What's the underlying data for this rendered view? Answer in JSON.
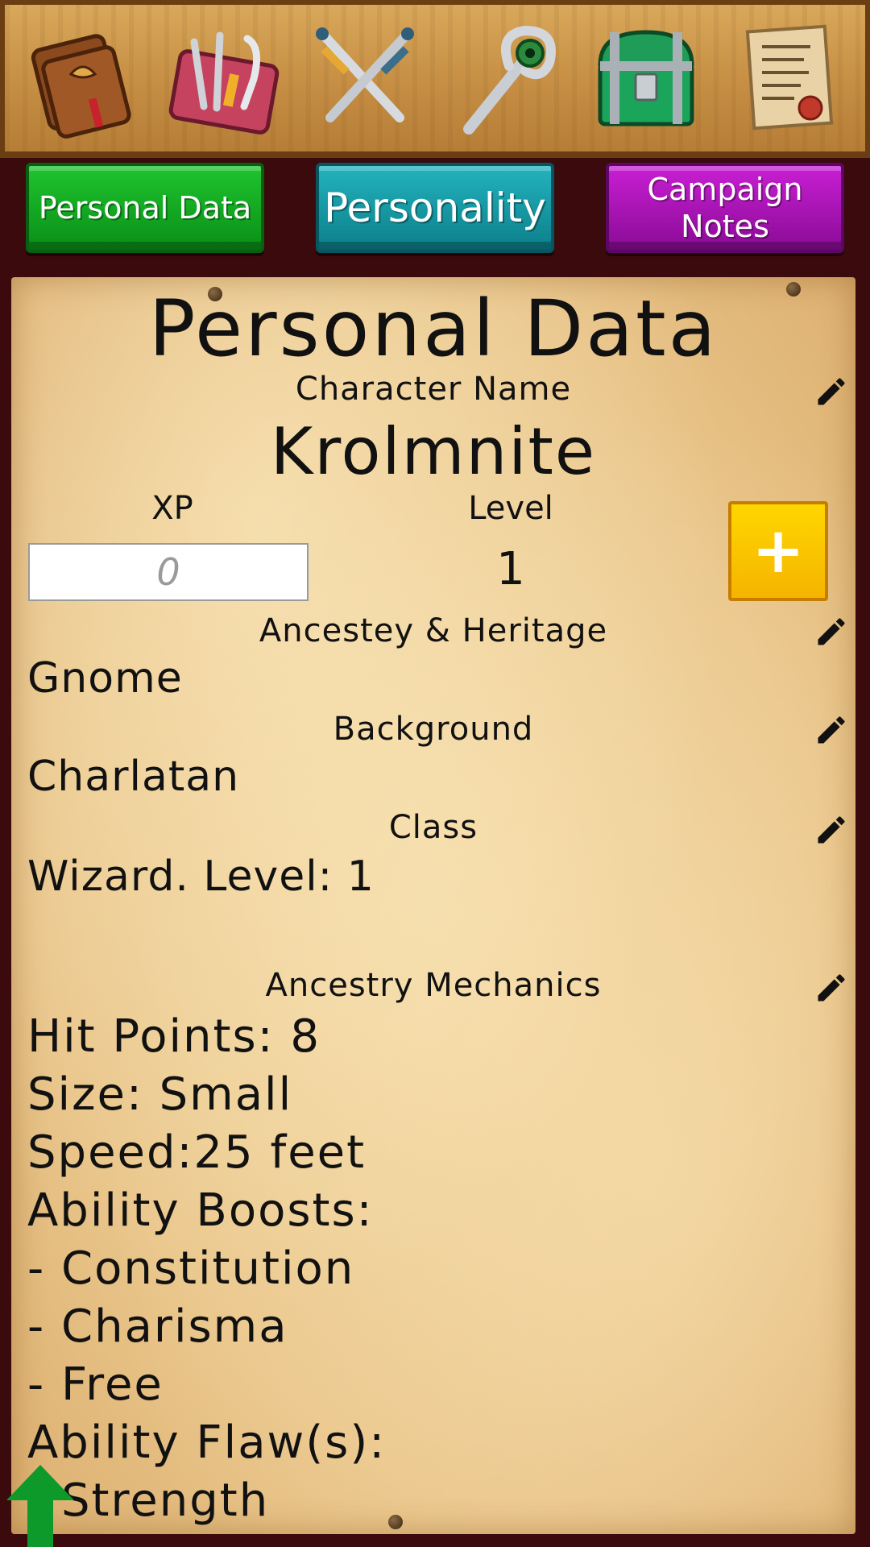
{
  "topbar": {
    "icons": [
      {
        "name": "spellbook-icon"
      },
      {
        "name": "tools-icon"
      },
      {
        "name": "crossed-swords-icon"
      },
      {
        "name": "magic-staff-icon"
      },
      {
        "name": "treasure-chest-icon"
      },
      {
        "name": "scroll-icon"
      }
    ]
  },
  "tabs": {
    "personal_data": "Personal Data",
    "personality": "Personality",
    "campaign_notes": "Campaign\nNotes"
  },
  "colors": {
    "personal_tab": "#10a820",
    "personality_tab": "#1598a3",
    "campaign_tab": "#a911b5",
    "plus_button": "#fbc500",
    "arrow": "#0d9a2a"
  },
  "sheet": {
    "title": "Personal Data",
    "character_name_label": "Character Name",
    "character_name": "Krolmnite",
    "xp_label": "XP",
    "xp_placeholder": "0",
    "level_label": "Level",
    "level_value": "1",
    "plus_label": "+",
    "ancestry_label": "Ancestey & Heritage",
    "ancestry_value": "Gnome",
    "background_label": "Background",
    "background_value": "Charlatan",
    "class_label": "Class",
    "class_value": "Wizard. Level: 1",
    "mechanics_label": "Ancestry Mechanics",
    "mechanics_lines": [
      "Hit Points: 8",
      "Size: Small",
      "Speed:25 feet",
      "Ability Boosts:",
      "- Constitution",
      "- Charisma",
      "- Free",
      "Ability Flaw(s):",
      "- Strength"
    ]
  }
}
